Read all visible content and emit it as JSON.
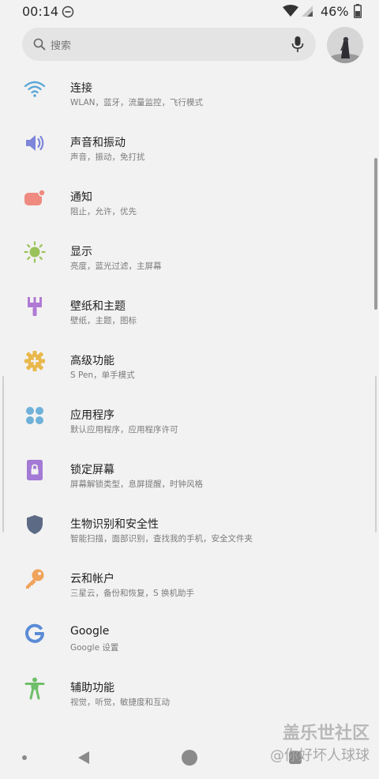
{
  "status_bar": {
    "time": "00:14",
    "battery_percent": "46%",
    "icons": [
      "do-not-disturb-icon",
      "wifi-icon",
      "signal-icon",
      "battery-icon"
    ]
  },
  "search": {
    "placeholder": "搜索"
  },
  "settings": [
    {
      "title": "连接",
      "subtitle": "WLAN，蓝牙，流量监控，飞行模式",
      "icon": "wifi-icon",
      "color": "#5aa8d6"
    },
    {
      "title": "声音和振动",
      "subtitle": "声音，振动，免打扰",
      "icon": "speaker-icon",
      "color": "#7d86d8"
    },
    {
      "title": "通知",
      "subtitle": "阻止，允许，优先",
      "icon": "notification-icon",
      "color": "#ef8a80"
    },
    {
      "title": "显示",
      "subtitle": "亮度，蓝光过滤，主屏幕",
      "icon": "brightness-icon",
      "color": "#9ac25a"
    },
    {
      "title": "壁纸和主题",
      "subtitle": "壁纸，主题，图标",
      "icon": "brush-icon",
      "color": "#b07ad4"
    },
    {
      "title": "高级功能",
      "subtitle": "S Pen，单手模式",
      "icon": "gear-plus-icon",
      "color": "#e9b84c"
    },
    {
      "title": "应用程序",
      "subtitle": "默认应用程序，应用程序许可",
      "icon": "apps-grid-icon",
      "color": "#6fb1d9"
    },
    {
      "title": "锁定屏幕",
      "subtitle": "屏幕解锁类型，息屏提醒，时钟风格",
      "icon": "lock-screen-icon",
      "color": "#a37ad6"
    },
    {
      "title": "生物识别和安全性",
      "subtitle": "智能扫描，面部识别，查找我的手机，安全文件夹",
      "icon": "shield-icon",
      "color": "#5c6a86"
    },
    {
      "title": "云和帐户",
      "subtitle": "三星云，备份和恢复，S 换机助手",
      "icon": "key-icon",
      "color": "#f0a35a"
    },
    {
      "title": "Google",
      "subtitle": "Google 设置",
      "icon": "google-icon",
      "color": "#5b8bd6"
    },
    {
      "title": "辅助功能",
      "subtitle": "视觉，听觉，敏捷度和互动",
      "icon": "accessibility-icon",
      "color": "#6fbf6a"
    }
  ],
  "watermark": {
    "line1": "盖乐世社区",
    "line2": "@你好坏人球球"
  },
  "nav_bar": {
    "icons": [
      "nav-dot-icon",
      "back-icon",
      "home-icon",
      "recent-apps-icon"
    ]
  }
}
